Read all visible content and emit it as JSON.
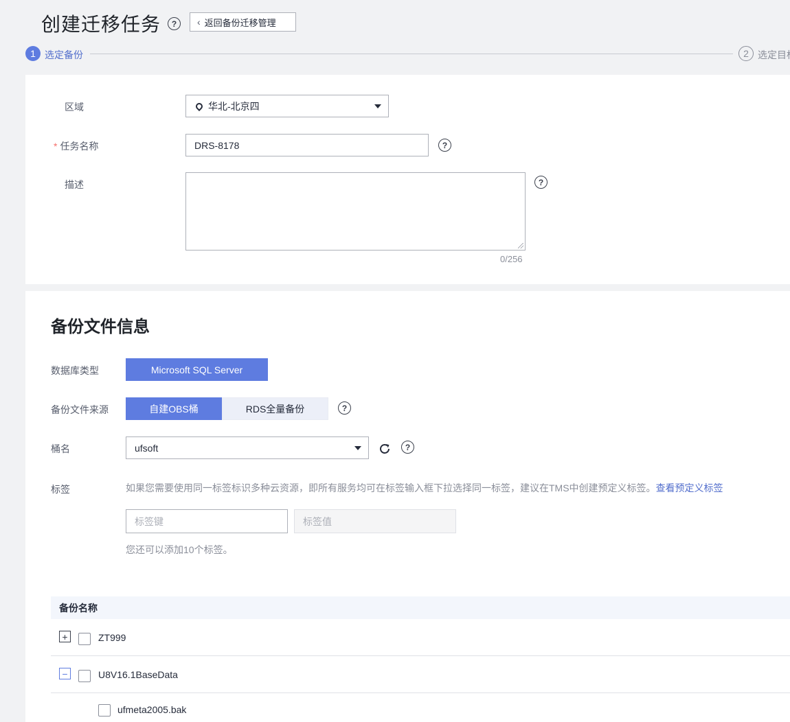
{
  "header": {
    "title": "创建迁移任务",
    "help_glyph": "?",
    "back_label": "返回备份迁移管理"
  },
  "steps": [
    {
      "num": "1",
      "label": "选定备份",
      "active": true
    },
    {
      "num": "2",
      "label": "选定目标",
      "active": false
    }
  ],
  "form": {
    "region_label": "区域",
    "region_value": "华北-北京四",
    "task_name_label": "任务名称",
    "task_name_required": "*",
    "task_name_value": "DRS-8178",
    "desc_label": "描述",
    "desc_counter": "0/256"
  },
  "backup": {
    "section_title": "备份文件信息",
    "db_type_label": "数据库类型",
    "db_type_value": "Microsoft SQL Server",
    "source_label": "备份文件来源",
    "source_options": [
      "自建OBS桶",
      "RDS全量备份"
    ],
    "bucket_label": "桶名",
    "bucket_value": "ufsoft",
    "tag_label": "标签",
    "tag_hint": "如果您需要使用同一标签标识多种云资源，即所有服务均可在标签输入框下拉选择同一标签，建议在TMS中创建预定义标签。",
    "tag_link": "查看预定义标签",
    "tag_key_placeholder": "标签键",
    "tag_value_placeholder": "标签值",
    "tag_remaining": "您还可以添加10个标签。"
  },
  "table": {
    "header": "备份名称",
    "rows": [
      {
        "name": "ZT999",
        "expander": "+"
      },
      {
        "name": "U8V16.1BaseData",
        "expander": "−"
      },
      {
        "name": "ufmeta2005.bak"
      }
    ]
  },
  "colors": {
    "accent": "#5e7ce0",
    "link": "#526ecc",
    "required": "#f66f6a"
  }
}
